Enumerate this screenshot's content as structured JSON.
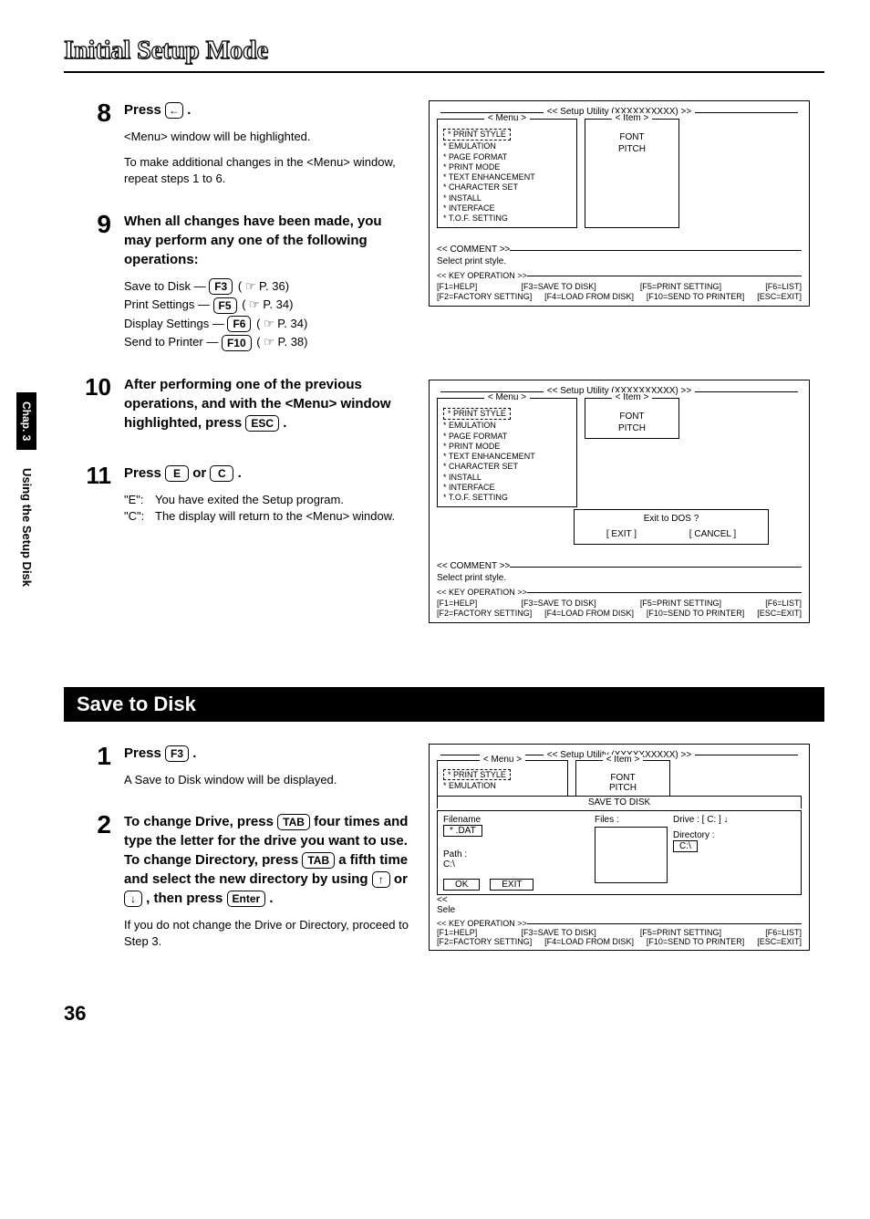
{
  "header": {
    "title": "Initial Setup Mode"
  },
  "sidebar": {
    "chapter": "Chap. 3",
    "section": "Using the Setup Disk"
  },
  "steps_a": [
    {
      "num": "8",
      "head_prefix": "Press ",
      "head_key": "←",
      "head_suffix": " .",
      "body": [
        "<Menu> window will be highlighted.",
        "To make additional changes in the <Menu> window, repeat steps 1 to 6."
      ]
    },
    {
      "num": "9",
      "head": "When all changes have been made, you may perform any one of the following operations:",
      "ops": [
        {
          "label": "Save to Disk — ",
          "key": "F3",
          "page": "( ☞  P. 36)"
        },
        {
          "label": "Print Settings — ",
          "key": "F5",
          "page": "( ☞  P. 34)"
        },
        {
          "label": "Display Settings — ",
          "key": "F6",
          "page": "( ☞  P. 34)"
        },
        {
          "label": "Send to Printer — ",
          "key": "F10",
          "page": "( ☞  P. 38)"
        }
      ]
    },
    {
      "num": "10",
      "head_parts": {
        "p1": "After performing one of the previous operations, and with the <Menu> window highlighted, press ",
        "key": "ESC",
        "p2": " ."
      }
    },
    {
      "num": "11",
      "head_prefix": "Press ",
      "key1": "E",
      "mid": " or ",
      "key2": "C",
      "head_suffix": " .",
      "items": [
        {
          "k": "\"E\":",
          "v": "You have exited the Setup program."
        },
        {
          "k": "\"C\":",
          "v": "The display will return to the <Menu> window."
        }
      ]
    }
  ],
  "tui": {
    "title": "<<  Setup Utility (XXXXXXXXXX)  >>",
    "menu_label": "< Menu >",
    "item_label": "< Item >",
    "menu_items": [
      "PRINT STYLE",
      "EMULATION",
      "PAGE FORMAT",
      "PRINT MODE",
      "TEXT ENHANCEMENT",
      "CHARACTER SET",
      "INSTALL",
      "INTERFACE",
      "T.O.F. SETTING"
    ],
    "item_items": [
      "FONT",
      "PITCH"
    ],
    "comment_label": "<<  COMMENT  >>",
    "comment_text": "Select print style.",
    "keyop_label": "<<  KEY OPERATION  >>",
    "keys_row1": [
      "[F1=HELP]",
      "[F3=SAVE TO DISK]",
      "[F5=PRINT SETTING]",
      "[F6=LIST]"
    ],
    "keys_row2": [
      "[F2=FACTORY SETTING]",
      "[F4=LOAD FROM DISK]",
      "[F10=SEND TO PRINTER]",
      "[ESC=EXIT]"
    ]
  },
  "tui_exit": {
    "dialog_title": "Exit to DOS ?",
    "btn_exit": "[  EXIT  ]",
    "btn_cancel": "[  CANCEL  ]"
  },
  "section_bar": "Save to Disk",
  "steps_b": [
    {
      "num": "1",
      "head_prefix": "Press ",
      "key": "F3",
      "head_suffix": " .",
      "body": "A Save to Disk window will be displayed."
    },
    {
      "num": "2",
      "parts": {
        "p1": "To change Drive, press ",
        "k1": "TAB",
        "p2": " four times and type the letter for the drive you want to use. To change Directory, press ",
        "k2": "TAB",
        "p3": " a fifth time and select the new directory by using ",
        "k3": "↑",
        "p4": " or ",
        "k4": "↓",
        "p5": " , then press ",
        "k5": "Enter",
        "p6": " ."
      },
      "body": "If you do not change the Drive or Directory, proceed to Step 3."
    }
  ],
  "save_tui": {
    "title": "<<  Setup Utility (XXXXXXXXXX)  >>",
    "menu_label": "< Menu >",
    "item_label": "< Item >",
    "menu_items_short": [
      "PRINT STYLE",
      "EMULATION"
    ],
    "item_items": [
      "FONT",
      "PITCH"
    ],
    "save_header": "SAVE TO DISK",
    "filename_label": "Filename",
    "filename_value": "* .DAT",
    "files_label": "Files  :",
    "drive_label": "Drive   :  [ C:  ] ↓",
    "directory_label": "Directory  :",
    "directory_value": "C:\\",
    "path_label": "Path  :",
    "path_value": "C:\\",
    "btn_ok": "OK",
    "btn_exit": "EXIT",
    "sel_hint": "<<",
    "sel_hint2": "Sele"
  },
  "page_number": "36"
}
